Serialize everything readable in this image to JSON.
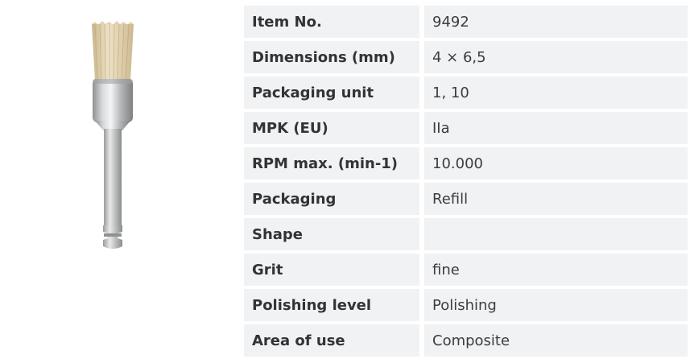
{
  "product": {
    "image_icon": "polishing-brush-icon"
  },
  "specs": [
    {
      "label": "Item No.",
      "value": "9492"
    },
    {
      "label": "Dimensions (mm)",
      "value": "4 × 6,5"
    },
    {
      "label": "Packaging unit",
      "value": "1, 10"
    },
    {
      "label": "MPK (EU)",
      "value": "IIa"
    },
    {
      "label": "RPM max. (min-1)",
      "value": "10.000"
    },
    {
      "label": "Packaging",
      "value": "Refill"
    },
    {
      "label": "Shape",
      "value": ""
    },
    {
      "label": "Grit",
      "value": "fine"
    },
    {
      "label": "Polishing level",
      "value": "Polishing"
    },
    {
      "label": "Area of use",
      "value": "Composite"
    }
  ],
  "colors": {
    "row_background": "#f1f2f3",
    "bristle": "#e6d6b2",
    "metal": "#b8babb"
  }
}
